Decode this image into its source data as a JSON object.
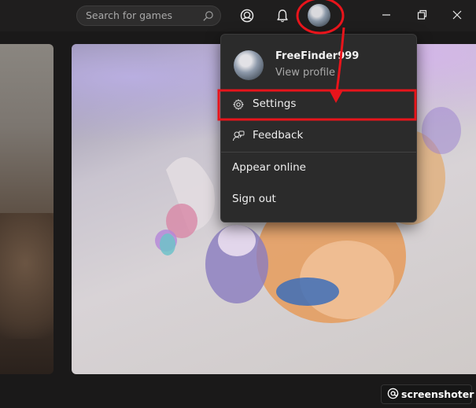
{
  "titlebar": {
    "search": {
      "placeholder": "Search for games",
      "icon": "search-icon"
    },
    "icons": [
      "friends-icon",
      "bell-icon",
      "avatar"
    ],
    "window_controls": [
      "minimize-icon",
      "restore-icon",
      "close-icon"
    ]
  },
  "profile_menu": {
    "gamertag": "FreeFinder999",
    "view_profile": "View profile",
    "items": [
      {
        "label": "Settings",
        "icon": "gear-icon",
        "highlighted": true
      },
      {
        "label": "Feedback",
        "icon": "feedback-icon"
      },
      {
        "label": "Appear online"
      },
      {
        "label": "Sign out"
      }
    ]
  },
  "annotations": {
    "color": "#e8141b"
  },
  "watermark": {
    "text": "screenshoter"
  }
}
